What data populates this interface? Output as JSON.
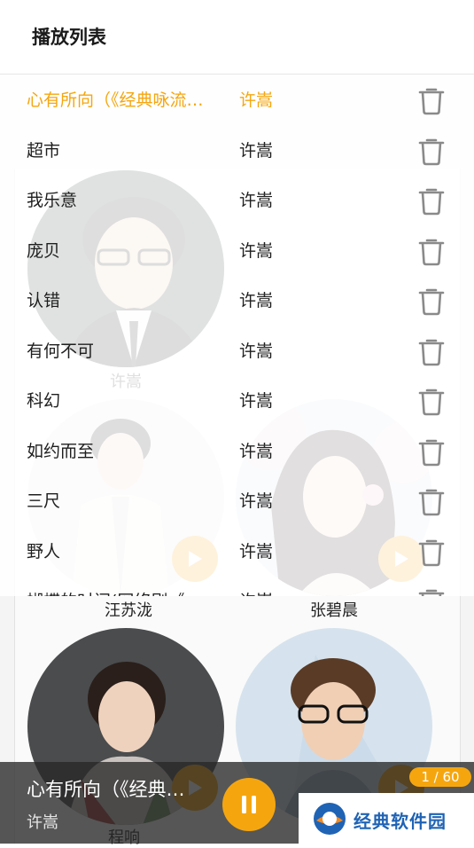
{
  "colors": {
    "accent": "#f5a60f",
    "text": "#1e1e1e",
    "player_bg": "#2b2b2b"
  },
  "sheet": {
    "title": "播放列表",
    "songs": [
      {
        "title": "心有所向（《经典咏流…",
        "artist": "许嵩",
        "active": true
      },
      {
        "title": "超市",
        "artist": "许嵩"
      },
      {
        "title": "我乐意",
        "artist": "许嵩"
      },
      {
        "title": "庞贝",
        "artist": "许嵩"
      },
      {
        "title": "认错",
        "artist": "许嵩"
      },
      {
        "title": "有何不可",
        "artist": "许嵩"
      },
      {
        "title": "科幻",
        "artist": "许嵩"
      },
      {
        "title": "如约而至",
        "artist": "许嵩"
      },
      {
        "title": "三尺",
        "artist": "许嵩"
      },
      {
        "title": "野人",
        "artist": "许嵩"
      },
      {
        "title": "蝴蝶的时间(网络剧《...",
        "artist": "许嵩"
      }
    ],
    "delete_icon": "trash-icon"
  },
  "background": {
    "artists": [
      {
        "name": "许嵩"
      },
      {
        "name": "汪苏泷"
      },
      {
        "name": "张碧晨"
      },
      {
        "name": "程响"
      },
      {
        "name": ""
      }
    ],
    "play_icon": "play-icon"
  },
  "player": {
    "title": "心有所向（《经典咏流传》",
    "artist": "许嵩",
    "counter": "1 / 60",
    "pause_icon": "pause-icon"
  },
  "watermark": {
    "text": "经典软件园"
  }
}
